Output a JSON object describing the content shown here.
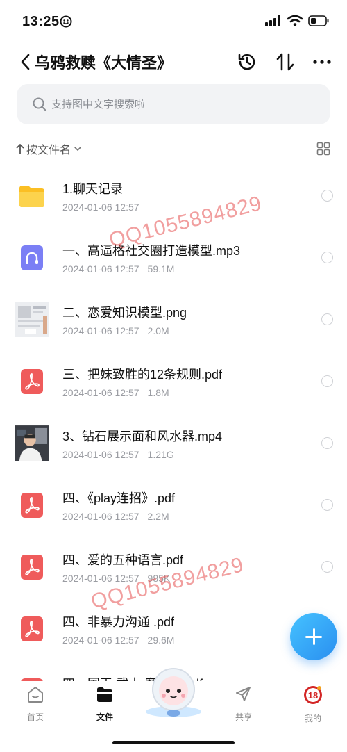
{
  "status_bar": {
    "time": "13:25"
  },
  "nav": {
    "title": "乌鸦救赎《大情圣》"
  },
  "search": {
    "placeholder": "支持图中文字搜索啦"
  },
  "sort": {
    "label": "按文件名"
  },
  "files": [
    {
      "name": "1.聊天记录",
      "date": "2024-01-06 12:57",
      "size": "",
      "type": "folder"
    },
    {
      "name": "一、高逼格社交圈打造模型.mp3",
      "date": "2024-01-06 12:57",
      "size": "59.1M",
      "type": "audio"
    },
    {
      "name": "二、恋爱知识模型.png",
      "date": "2024-01-06 12:57",
      "size": "2.0M",
      "type": "image"
    },
    {
      "name": "三、把妹致胜的12条规则.pdf",
      "date": "2024-01-06 12:57",
      "size": "1.8M",
      "type": "pdf"
    },
    {
      "name": "3、钻石展示面和风水器.mp4",
      "date": "2024-01-06 12:57",
      "size": "1.21G",
      "type": "video"
    },
    {
      "name": "四、《play连招》.pdf",
      "date": "2024-01-06 12:57",
      "size": "2.2M",
      "type": "pdf"
    },
    {
      "name": "四、爱的五种语言.pdf",
      "date": "2024-01-06 12:57",
      "size": "985K",
      "type": "pdf"
    },
    {
      "name": "四、非暴力沟通 .pdf",
      "date": "2024-01-06 12:57",
      "size": "29.6M",
      "type": "pdf"
    },
    {
      "name": "四、国王 武士 魔法师.pdf",
      "date": "",
      "size": "",
      "type": "pdf"
    }
  ],
  "watermarks": [
    "QQ1055894829",
    "QQ1055894829"
  ],
  "tabs": [
    {
      "label": "首页",
      "icon": "home-icon"
    },
    {
      "label": "文件",
      "icon": "folder-icon"
    },
    {
      "label": "共享",
      "icon": "share-icon"
    },
    {
      "label": "我的",
      "icon": "profile-avatar-icon"
    }
  ],
  "avatar_badge": "18",
  "colors": {
    "accent": "#2a8ff0",
    "pdf_red": "#ef5b5b",
    "folder_yellow": "#fcd34d",
    "audio_purple": "#7b7ff5"
  }
}
